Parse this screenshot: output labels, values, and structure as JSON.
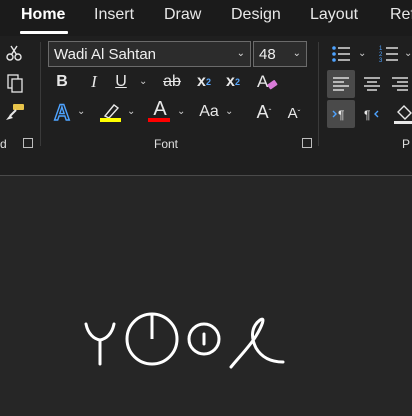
{
  "tabs": [
    {
      "label": "Home",
      "active": true
    },
    {
      "label": "Insert"
    },
    {
      "label": "Draw"
    },
    {
      "label": "Design"
    },
    {
      "label": "Layout"
    },
    {
      "label": "Ref"
    }
  ],
  "clipboard": {
    "label_fragment": "d"
  },
  "font": {
    "group_label": "Font",
    "font_name": "Wadi Al Sahtan",
    "font_size": "48",
    "highlight_color": "#ffff00",
    "font_color": "#ff0000",
    "change_case_label": "Aa",
    "bold": "B",
    "italic": "I",
    "underline": "U",
    "strike": "ab",
    "subscript": "x",
    "superscript": "x",
    "sub_mark": "2",
    "sup_mark": "2",
    "grow": "A",
    "shrink": "A",
    "text_effects": "A",
    "font_color_glyph": "A"
  },
  "paragraph": {
    "label_fragment": "P"
  }
}
